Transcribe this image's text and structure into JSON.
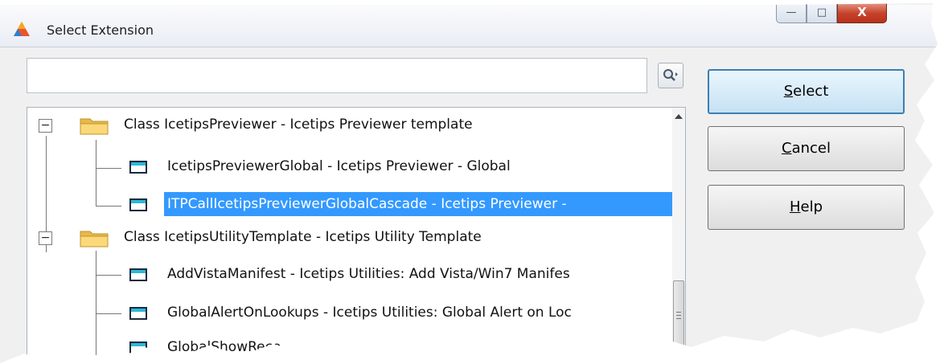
{
  "window": {
    "title": "Select Extension"
  },
  "caption_buttons": {
    "minimize": "—",
    "maximize": "□",
    "close": "X"
  },
  "search": {
    "value": "",
    "placeholder": ""
  },
  "tree": {
    "items": [
      {
        "label": "Class IcetipsPreviewer - Icetips Previewer template",
        "expander": "−"
      },
      {
        "label": "IcetipsPreviewerGlobal - Icetips Previewer - Global"
      },
      {
        "label": "ITPCallIcetipsPreviewerGlobalCascade - Icetips Previewer - ",
        "selected": true
      },
      {
        "label": "Class IcetipsUtilityTemplate - Icetips Utility Template",
        "expander": "−"
      },
      {
        "label": "AddVistaManifest - Icetips Utilities: Add Vista/Win7 Manifes"
      },
      {
        "label": "GlobalAlertOnLookups - Icetips Utilities: Global Alert on Loc"
      },
      {
        "label": "GlobalShowReco"
      }
    ]
  },
  "buttons": {
    "select": {
      "mnemonic": "S",
      "rest": "elect"
    },
    "cancel": {
      "mnemonic": "C",
      "rest": "ancel"
    },
    "help": {
      "mnemonic": "H",
      "rest": "elp"
    }
  },
  "colors": {
    "selection": "#3399ff",
    "default_button_border": "#3c7fb1",
    "close_button": "#c7432b"
  }
}
